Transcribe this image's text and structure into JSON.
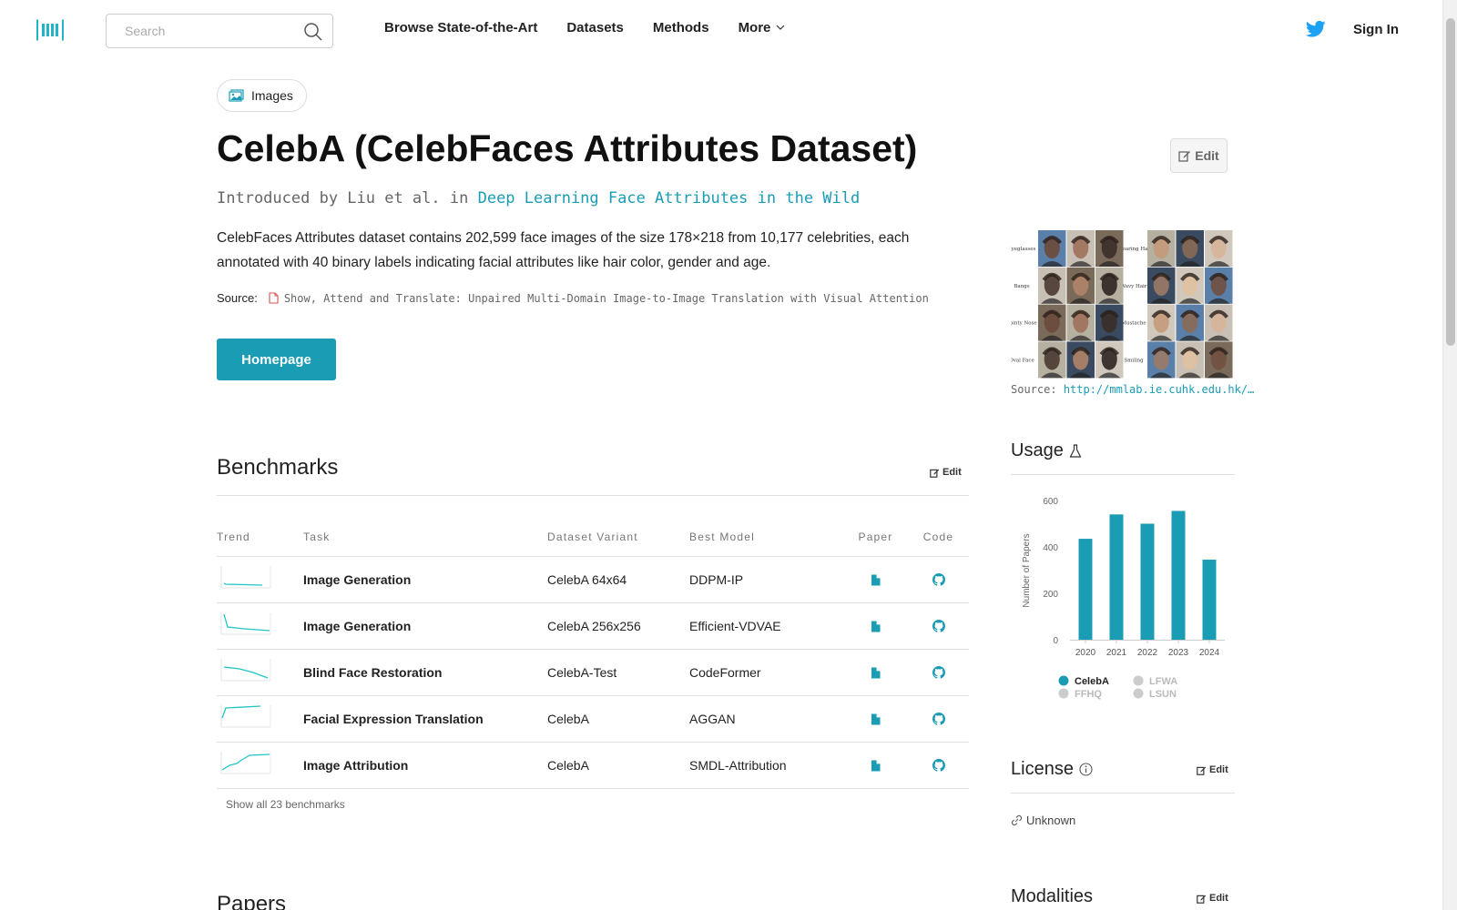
{
  "nav": {
    "search_placeholder": "Search",
    "links": [
      "Browse State-of-the-Art",
      "Datasets",
      "Methods",
      "More"
    ],
    "sign_in": "Sign In",
    "accent": "#1a9cb4"
  },
  "chip": {
    "label": "Images"
  },
  "dataset": {
    "title": "CelebA (CelebFaces Attributes Dataset)",
    "intro_prefix": "Introduced by Liu et al. in",
    "intro_paper": "Deep Learning Face Attributes in the Wild",
    "description": "CelebFaces Attributes dataset contains 202,599 face images of the size 178×218 from 10,177 celebrities, each annotated with 40 binary labels indicating facial attributes like hair color, gender and age.",
    "source_label": "Source:",
    "source_text": "Show, Attend and Translate: Unpaired Multi-Domain Image-to-Image Translation with Visual Attention",
    "homepage": "Homepage",
    "edit": "Edit"
  },
  "image": {
    "source_label": "Source:",
    "source_url": "http://mmlab.ie.cuhk.edu.hk/…",
    "attribute_labels": [
      "Eyeglasses",
      "Wearing Hat",
      "Bangs",
      "Wavy Hair",
      "Pointy Nose",
      "Mustache",
      "Oval Face",
      "Smiling"
    ]
  },
  "benchmarks": {
    "title": "Benchmarks",
    "edit": "Edit",
    "headers": [
      "Trend",
      "Task",
      "Dataset Variant",
      "Best Model",
      "Paper",
      "Code"
    ],
    "rows": [
      {
        "task": "Image Generation",
        "variant": "CelebA 64x64",
        "model": "DDPM-IP"
      },
      {
        "task": "Image Generation",
        "variant": "CelebA 256x256",
        "model": "Efficient-VDVAE"
      },
      {
        "task": "Blind Face Restoration",
        "variant": "CelebA-Test",
        "model": "CodeFormer"
      },
      {
        "task": "Facial Expression Translation",
        "variant": "CelebA",
        "model": "AGGAN"
      },
      {
        "task": "Image Attribution",
        "variant": "CelebA",
        "model": "SMDL-Attribution"
      }
    ],
    "show_all": "Show all 23 benchmarks"
  },
  "papers": {
    "title": "Papers"
  },
  "usage": {
    "title": "Usage"
  },
  "chart_data": {
    "type": "bar",
    "categories": [
      "2020",
      "2021",
      "2022",
      "2023",
      "2024"
    ],
    "values": [
      435,
      540,
      500,
      555,
      345
    ],
    "ylabel": "Number of Papers",
    "yticks": [
      0,
      200,
      400,
      600
    ],
    "ylim": [
      0,
      600
    ],
    "color": "#1a9cb4",
    "legend": [
      {
        "name": "CelebA",
        "active": true
      },
      {
        "name": "LFWA",
        "active": false
      },
      {
        "name": "FFHQ",
        "active": false
      },
      {
        "name": "LSUN",
        "active": false
      }
    ]
  },
  "license": {
    "title": "License",
    "edit": "Edit",
    "value": "Unknown"
  },
  "modalities": {
    "title": "Modalities",
    "edit": "Edit"
  }
}
